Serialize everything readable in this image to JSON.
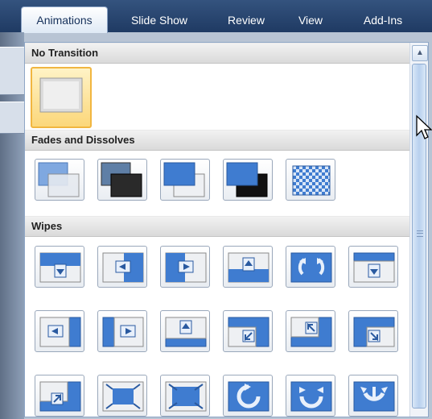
{
  "ribbon": {
    "tabs": [
      {
        "label": "Animations",
        "active": true
      },
      {
        "label": "Slide Show",
        "active": false
      },
      {
        "label": "Review",
        "active": false
      },
      {
        "label": "View",
        "active": false
      },
      {
        "label": "Add-Ins",
        "active": false
      }
    ]
  },
  "gallery": {
    "sections": [
      {
        "title": "No Transition",
        "items": [
          "no-transition"
        ]
      },
      {
        "title": "Fades and Dissolves",
        "items": [
          "fade-smoothly",
          "fade-through-black",
          "cut",
          "cut-through-black",
          "dissolve"
        ]
      },
      {
        "title": "Wipes",
        "items": [
          "wipe-down",
          "wipe-left",
          "wipe-right",
          "wipe-up",
          "wedge",
          "uncover-down",
          "uncover-left",
          "uncover-right",
          "uncover-up",
          "uncover-left-down",
          "uncover-left-up",
          "uncover-right-down",
          "uncover-right-up",
          "box-in",
          "box-out",
          "wheel-clockwise-1-spoke",
          "wheel-clockwise-2-spokes",
          "wheel-clockwise-3-spokes"
        ]
      }
    ],
    "selected": "no-transition"
  },
  "colors": {
    "tab_bar": "#1f3a63",
    "selection": "#f1b640",
    "slide_blue": "#3f7cd0"
  }
}
